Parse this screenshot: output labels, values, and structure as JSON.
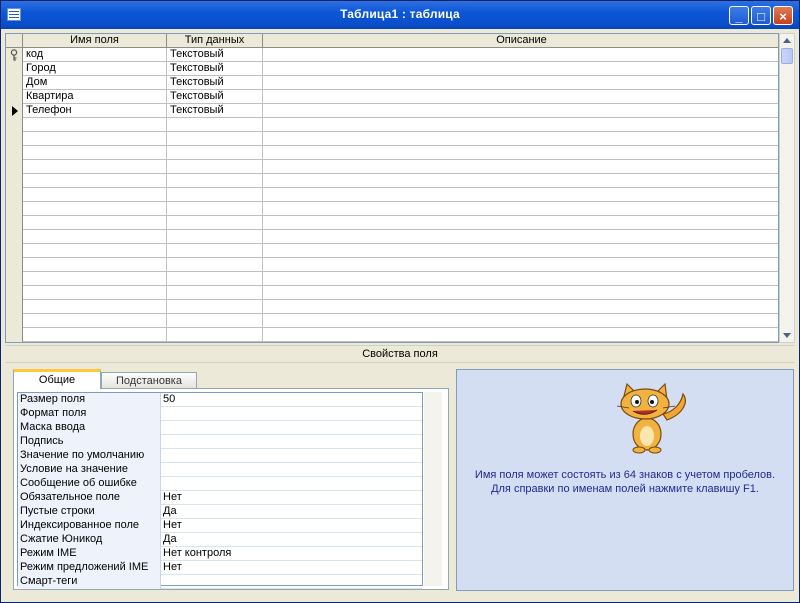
{
  "window": {
    "title": "Таблица1 : таблица",
    "min_symbol": "_",
    "max_symbol": "□",
    "close_symbol": "×"
  },
  "grid": {
    "headers": [
      "Имя поля",
      "Тип данных",
      "Описание"
    ],
    "rows": [
      {
        "name": "код",
        "type": "Текстовый",
        "desc": "",
        "primary_key": true
      },
      {
        "name": "Город",
        "type": "Текстовый",
        "desc": ""
      },
      {
        "name": "Дом",
        "type": "Текстовый",
        "desc": ""
      },
      {
        "name": "Квартира",
        "type": "Текстовый",
        "desc": ""
      },
      {
        "name": "Телефон",
        "type": "Текстовый",
        "desc": "",
        "current": true
      }
    ],
    "empty_rows": 16
  },
  "properties": {
    "section_title": "Свойства поля",
    "tabs": [
      "Общие",
      "Подстановка"
    ],
    "rows": [
      {
        "label": "Размер поля",
        "value": "50"
      },
      {
        "label": "Формат поля",
        "value": ""
      },
      {
        "label": "Маска ввода",
        "value": ""
      },
      {
        "label": "Подпись",
        "value": ""
      },
      {
        "label": "Значение по умолчанию",
        "value": ""
      },
      {
        "label": "Условие на значение",
        "value": ""
      },
      {
        "label": "Сообщение об ошибке",
        "value": ""
      },
      {
        "label": "Обязательное поле",
        "value": "Нет"
      },
      {
        "label": "Пустые строки",
        "value": "Да"
      },
      {
        "label": "Индексированное поле",
        "value": "Нет"
      },
      {
        "label": "Сжатие Юникод",
        "value": "Да"
      },
      {
        "label": "Режим IME",
        "value": "Нет контроля"
      },
      {
        "label": "Режим предложений IME",
        "value": "Нет"
      },
      {
        "label": "Смарт-теги",
        "value": ""
      }
    ]
  },
  "help": {
    "line1": "Имя поля может состоять из 64 знаков с учетом пробелов.",
    "line2": "Для справки по именам полей нажмите клавишу F1."
  },
  "colors": {
    "titlebar": "#0a4fcb",
    "help_bg": "#d4def2",
    "help_text": "#1f2a8f"
  }
}
